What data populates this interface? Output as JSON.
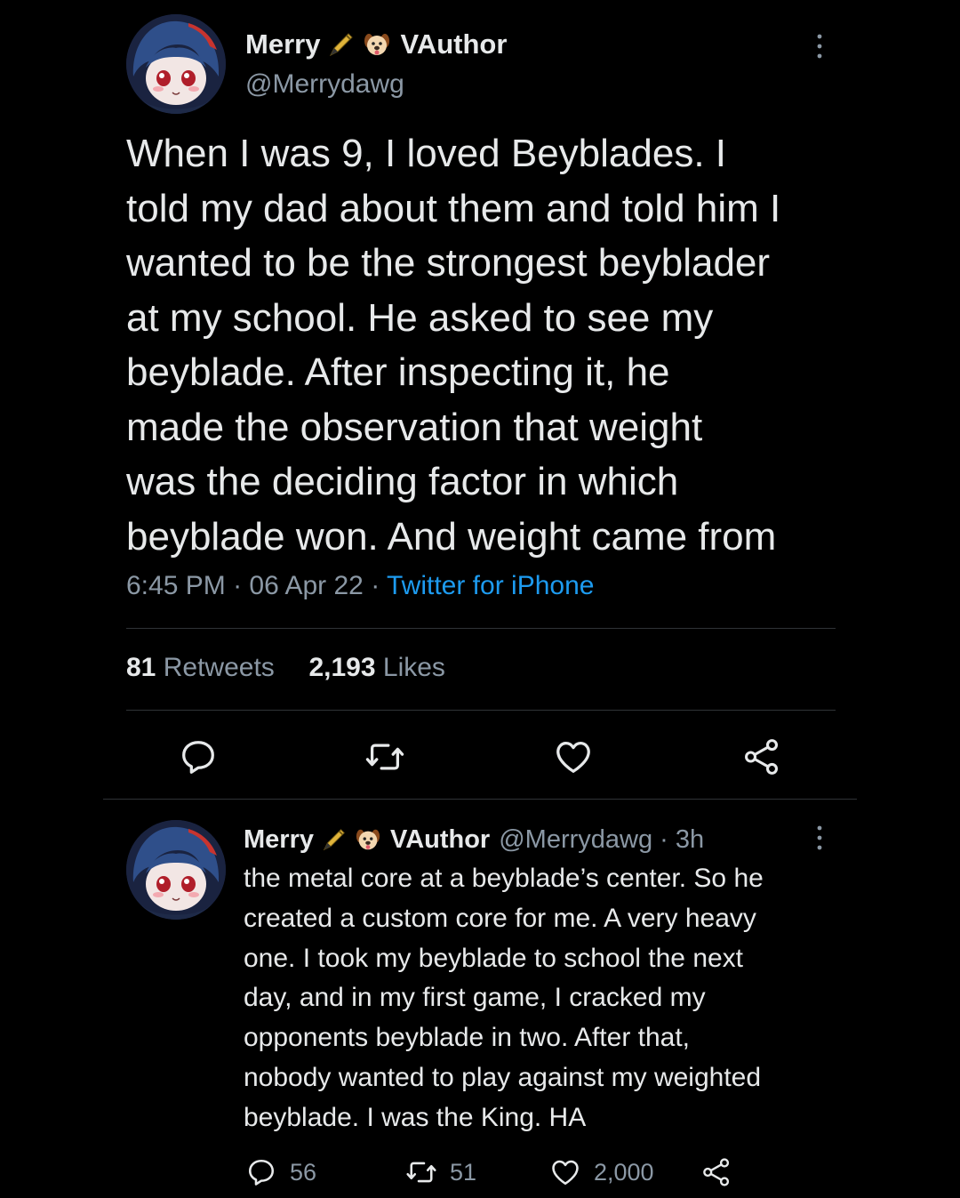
{
  "tweet": {
    "author_name": "Merry",
    "author_name_suffix": "VAuthor",
    "handle": "@Merrydawg",
    "text_lines": [
      "When I was 9, I loved Beyblades. I",
      "told my dad about them and told him I",
      "wanted to be the strongest beyblader",
      "at my school. He asked to see my",
      "beyblade. After inspecting it, he",
      "made the observation that weight",
      "was the deciding factor in which",
      "beyblade won. And weight came from"
    ],
    "time": "6:45 PM",
    "date": "06 Apr 22",
    "separator": "·",
    "source": "Twitter for iPhone",
    "retweets_count": "81",
    "retweets_label": "Retweets",
    "likes_count": "2,193",
    "likes_label": "Likes"
  },
  "reply": {
    "author_name": "Merry",
    "author_name_suffix": "VAuthor",
    "handle_time": "@Merrydawg · 3h",
    "text_lines": [
      "the metal core at a beyblade’s center. So he",
      "created a custom core for me. A very heavy",
      "one. I took my beyblade to school the next",
      "day, and in my first game, I cracked my",
      "opponents beyblade in two. After that,",
      "nobody wanted to play against my weighted",
      "beyblade. I was the King. HA"
    ],
    "replies_count": "56",
    "retweets_count": "51",
    "likes_count": "2,000"
  },
  "icons": {
    "name_emojis": [
      "pen-icon",
      "dog-face-icon"
    ],
    "actions": [
      "reply-icon",
      "retweet-icon",
      "like-icon",
      "share-icon"
    ],
    "more": "more-dots-icon"
  },
  "colors": {
    "background": "#000000",
    "text": "#e7e9ea",
    "secondary": "#8b98a5",
    "link": "#1d9bf0",
    "divider": "#2f3336"
  }
}
